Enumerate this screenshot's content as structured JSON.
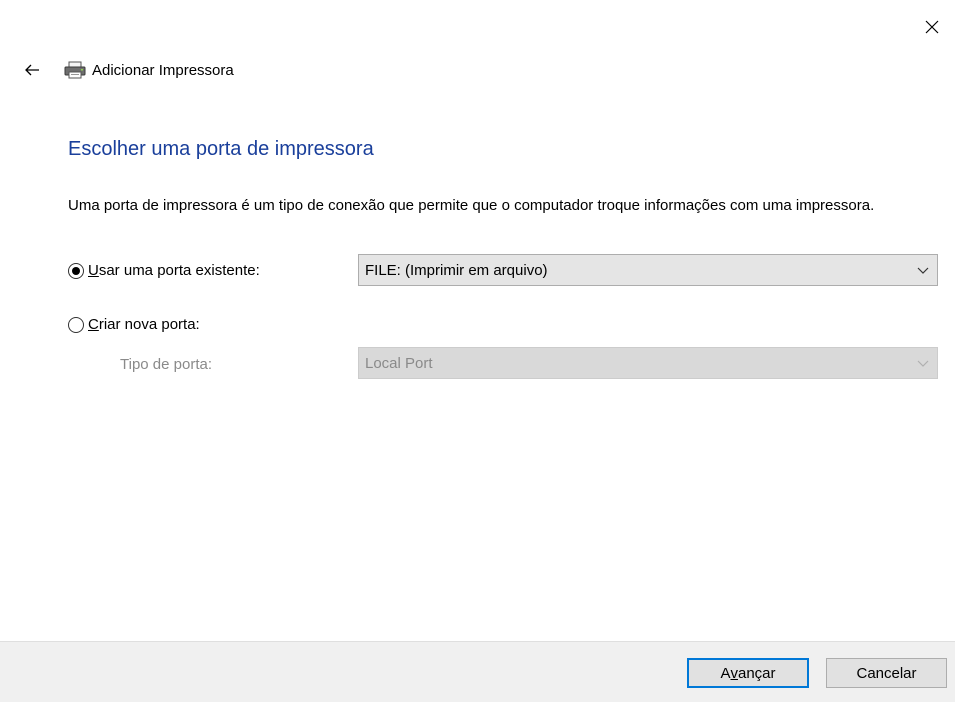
{
  "window": {
    "title": "Adicionar Impressora",
    "close_icon": "close-icon",
    "back_icon": "arrow-left-icon",
    "app_icon": "printer-icon"
  },
  "page": {
    "heading": "Escolher uma porta de impressora",
    "description": "Uma porta de impressora é um tipo de conexão que permite que o computador troque informações com uma impressora."
  },
  "options": {
    "existing": {
      "label_mnemonic": "U",
      "label_rest": "sar uma porta existente:",
      "selected": true,
      "value": "FILE: (Imprimir em arquivo)"
    },
    "new": {
      "label_mnemonic": "C",
      "label_rest": "riar nova porta:",
      "selected": false,
      "port_type_label": "Tipo de porta:",
      "port_type_value": "Local Port"
    }
  },
  "footer": {
    "next_pre": "A",
    "next_mnemonic": "v",
    "next_post": "ançar",
    "cancel_label": "Cancelar"
  },
  "colors": {
    "heading": "#1a3f9b",
    "primary_border": "#0078d7",
    "footer_bg": "#f0f0f0"
  }
}
